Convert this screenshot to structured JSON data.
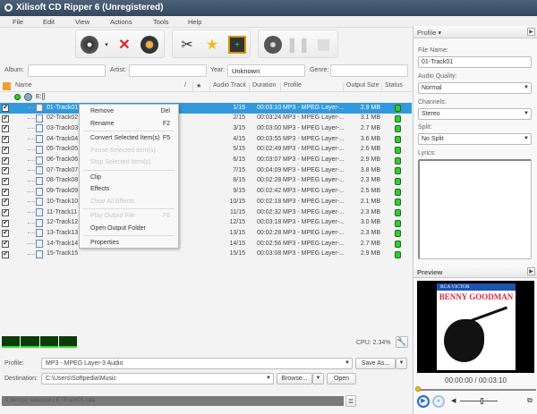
{
  "window": {
    "title": "Xilisoft CD Ripper 6 (Unregistered)"
  },
  "menu": [
    "File",
    "Edit",
    "View",
    "Actions",
    "Tools",
    "Help"
  ],
  "toolbar": {
    "icons": [
      "cd-rip-icon",
      "delete-icon",
      "cd-info-icon",
      "clip-scissors-icon",
      "effects-star-icon",
      "add-to-output-icon",
      "cd-play-icon",
      "pause-icon",
      "stop-icon"
    ]
  },
  "fields": {
    "album_label": "Album:",
    "album": "",
    "artist_label": "Artist:",
    "artist": "",
    "year_label": "Year:",
    "year": "Unknown",
    "genre_label": "Genre:",
    "genre": ""
  },
  "table": {
    "headers": {
      "name": "Name",
      "sort": "/",
      "star": "★",
      "audio_track": "Audio Track",
      "duration": "Duration",
      "profile": "Profile",
      "output_size": "Output Size",
      "status": "Status"
    },
    "drive": "E:[]",
    "rows": [
      {
        "name": "01-Track01",
        "track": "1/15",
        "duration": "00:03:10",
        "profile": "MP3 - MPEG Layer-...",
        "size": "2.9 MB"
      },
      {
        "name": "02-Track02",
        "track": "2/15",
        "duration": "00:03:24",
        "profile": "MP3 - MPEG Layer-...",
        "size": "3.1 MB"
      },
      {
        "name": "03-Track03",
        "track": "3/15",
        "duration": "00:03:00",
        "profile": "MP3 - MPEG Layer-...",
        "size": "2.7 MB"
      },
      {
        "name": "04-Track04",
        "track": "4/15",
        "duration": "00:03:55",
        "profile": "MP3 - MPEG Layer-...",
        "size": "3.6 MB"
      },
      {
        "name": "05-Track05",
        "track": "5/15",
        "duration": "00:02:49",
        "profile": "MP3 - MPEG Layer-...",
        "size": "2.6 MB"
      },
      {
        "name": "06-Track06",
        "track": "6/15",
        "duration": "00:03:07",
        "profile": "MP3 - MPEG Layer-...",
        "size": "2.9 MB"
      },
      {
        "name": "07-Track07",
        "track": "7/15",
        "duration": "00:04:09",
        "profile": "MP3 - MPEG Layer-...",
        "size": "3.8 MB"
      },
      {
        "name": "08-Track08",
        "track": "8/15",
        "duration": "00:02:28",
        "profile": "MP3 - MPEG Layer-...",
        "size": "2.3 MB"
      },
      {
        "name": "09-Track09",
        "track": "9/15",
        "duration": "00:02:42",
        "profile": "MP3 - MPEG Layer-...",
        "size": "2.5 MB"
      },
      {
        "name": "10-Track10",
        "track": "10/15",
        "duration": "00:02:18",
        "profile": "MP3 - MPEG Layer-...",
        "size": "2.1 MB"
      },
      {
        "name": "11-Track11",
        "track": "11/15",
        "duration": "00:02:32",
        "profile": "MP3 - MPEG Layer-...",
        "size": "2.3 MB"
      },
      {
        "name": "12-Track12",
        "track": "12/15",
        "duration": "00:03:18",
        "profile": "MP3 - MPEG Layer-...",
        "size": "3.0 MB"
      },
      {
        "name": "13-Track13",
        "track": "13/15",
        "duration": "00:02:28",
        "profile": "MP3 - MPEG Layer-...",
        "size": "2.3 MB"
      },
      {
        "name": "14-Track14",
        "track": "14/15",
        "duration": "00:02:56",
        "profile": "MP3 - MPEG Layer-...",
        "size": "2.7 MB"
      },
      {
        "name": "15-Track15",
        "track": "15/15",
        "duration": "00:03:08",
        "profile": "MP3 - MPEG Layer-...",
        "size": "2.9 MB"
      }
    ]
  },
  "context_menu": [
    {
      "label": "Remove",
      "shortcut": "Del",
      "enabled": true
    },
    {
      "label": "Rename",
      "shortcut": "F2",
      "enabled": true,
      "sep_after": true
    },
    {
      "label": "Convert Selected Item(s)",
      "shortcut": "F5",
      "enabled": true
    },
    {
      "label": "Pause Selected Item(s)",
      "shortcut": "",
      "enabled": false
    },
    {
      "label": "Stop Selected Item(s)",
      "shortcut": "",
      "enabled": false,
      "sep_after": true
    },
    {
      "label": "Clip",
      "shortcut": "",
      "enabled": true
    },
    {
      "label": "Effects",
      "shortcut": "",
      "enabled": true
    },
    {
      "label": "Clear All Effects",
      "shortcut": "",
      "enabled": false,
      "sep_after": true
    },
    {
      "label": "Play Output File",
      "shortcut": "F6",
      "enabled": false
    },
    {
      "label": "Open Output Folder",
      "shortcut": "",
      "enabled": true,
      "sep_after": true
    },
    {
      "label": "Properties",
      "shortcut": "",
      "enabled": true
    }
  ],
  "bottom": {
    "cpu": "CPU: 2.34%",
    "profile_label": "Profile:",
    "profile": "MP3 - MPEG Layer-3 Audio",
    "save_as": "Save As...",
    "destination_label": "Destination:",
    "destination": "C:\\Users\\Softpedia\\Music",
    "browse": "Browse...",
    "open": "Open",
    "status": "1 item(s) selected | E:\\Track01.cda"
  },
  "right_panel": {
    "header": "Profile ▾",
    "file_name_label": "File Name:",
    "file_name": "01-Track01",
    "audio_quality_label": "Audio Quality:",
    "audio_quality": "Normal",
    "channels_label": "Channels:",
    "channels": "Stereo",
    "split_label": "Split:",
    "split": "No Split",
    "lyrics_label": "Lyrics:",
    "lyrics": "",
    "preview_header": "Preview",
    "cover": {
      "label": "RCA VICTOR",
      "artist": "BENNY GOODMAN"
    },
    "time": "00:00:00 / 00:03:10",
    "volume": 0.6,
    "progress": 0
  },
  "colors": {
    "selection": "#3399dd",
    "status_ok": "#33cc33",
    "titlebar": "#3d5269"
  }
}
